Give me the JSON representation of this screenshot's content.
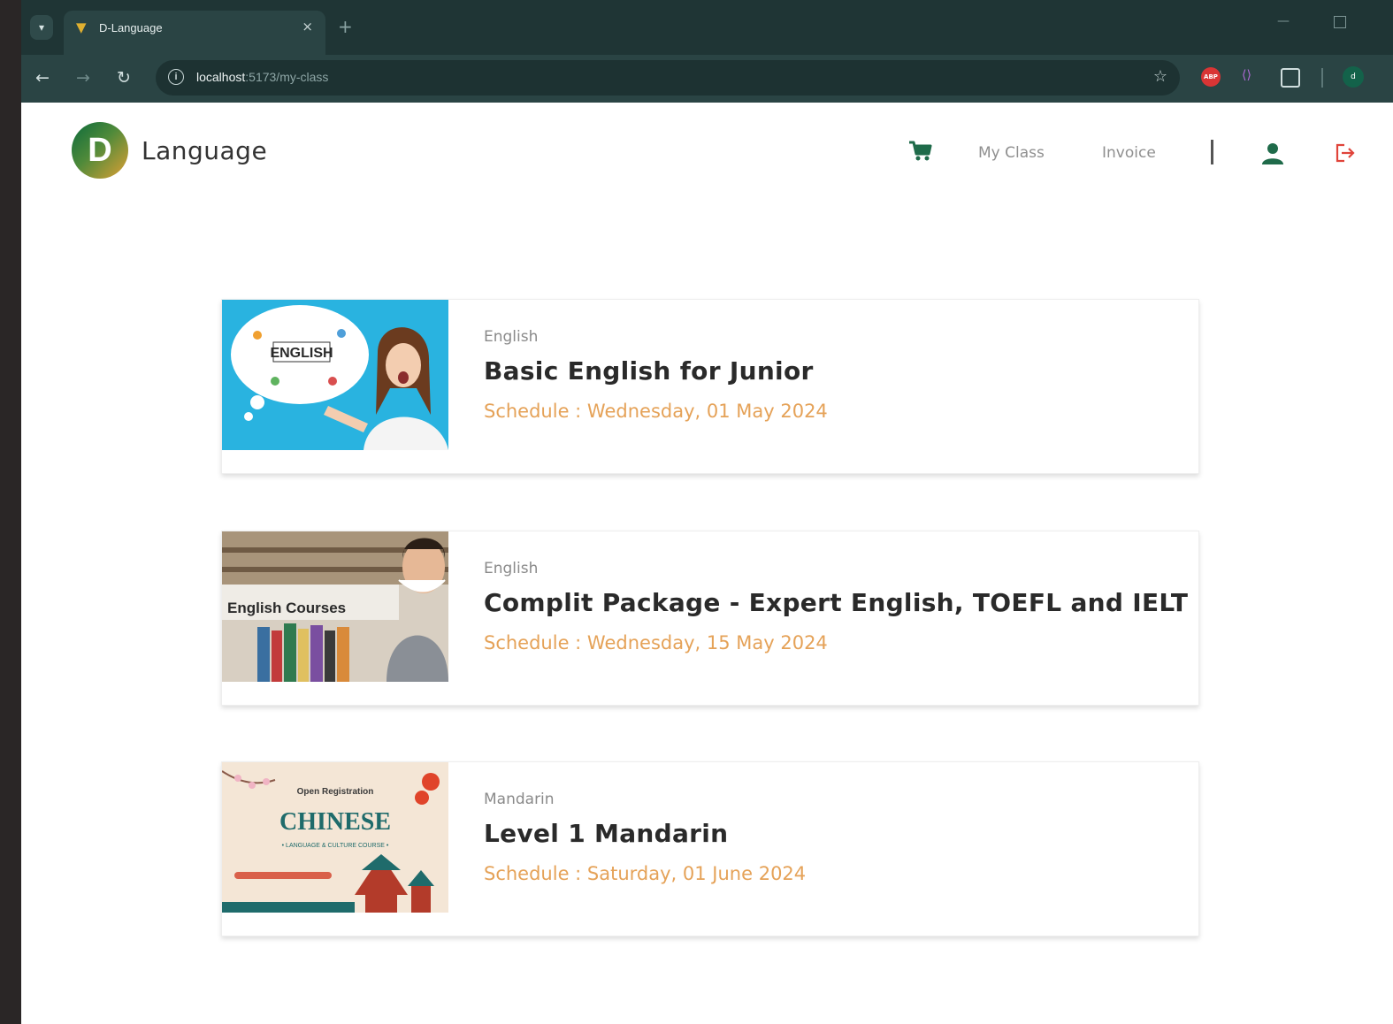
{
  "browser": {
    "tab_title": "D-Language",
    "tab_close": "×",
    "new_tab": "+",
    "url_host": "localhost",
    "url_path": ":5173/my-class",
    "extensions": {
      "abp_label": "ABP",
      "code_label": "⟨⟩",
      "avatar_label": "d"
    }
  },
  "header": {
    "logo_letter": "D",
    "brand": "Language",
    "nav": {
      "my_class": "My Class",
      "invoice": "Invoice"
    },
    "icons": [
      "cart-icon",
      "user-icon",
      "logout-icon"
    ]
  },
  "classes": [
    {
      "language": "English",
      "title": "Basic English for Junior",
      "schedule": "Schedule : Wednesday, 01 May 2024",
      "image_text": "ENGLISH"
    },
    {
      "language": "English",
      "title": "Complit Package - Expert English, TOEFL and IELT",
      "schedule": "Schedule : Wednesday, 15 May 2024",
      "image_text": "English Courses"
    },
    {
      "language": "Mandarin",
      "title": "Level 1 Mandarin",
      "schedule": "Schedule : Saturday, 01 June 2024",
      "image_text": {
        "top": "Open Registration",
        "main": "CHINESE",
        "sub": "• LANGUAGE & CULTURE COURSE •"
      }
    }
  ],
  "colors": {
    "brand_green": "#0b6a3c",
    "schedule_orange": "#e5a258",
    "logout_red": "#e0443a",
    "chrome_bg": "#1f3535"
  }
}
